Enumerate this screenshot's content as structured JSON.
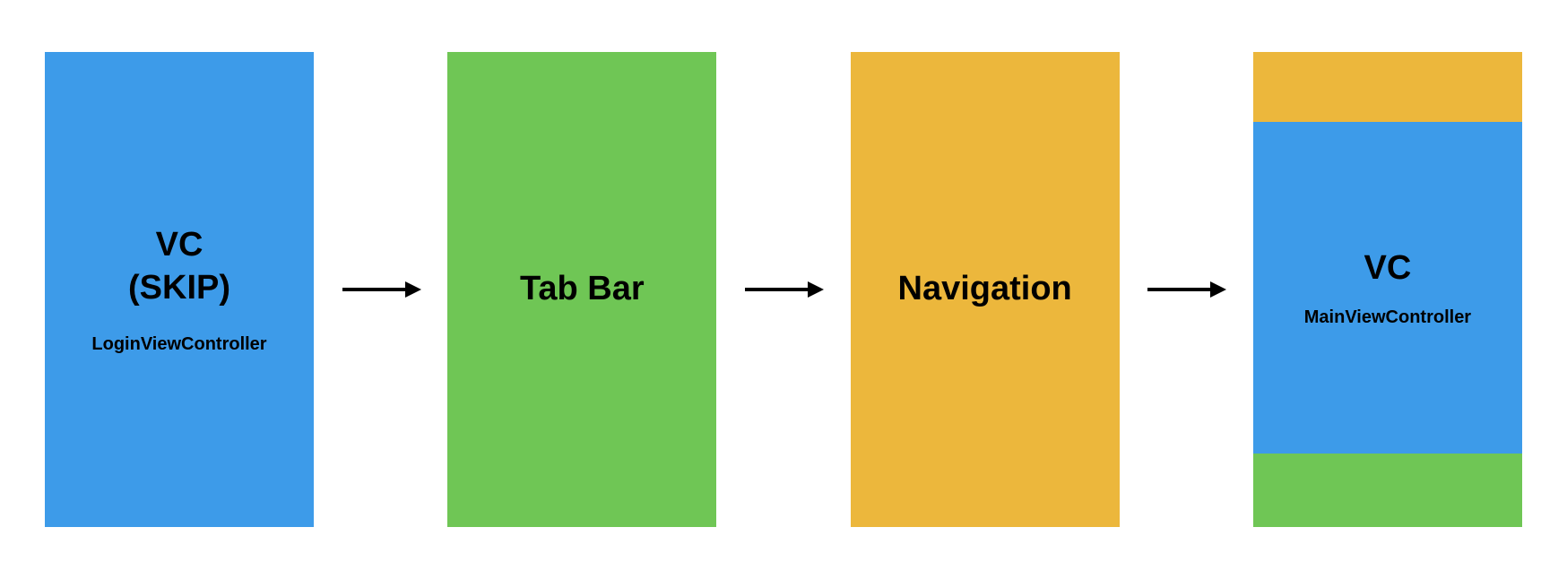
{
  "diagram": {
    "nodes": [
      {
        "type": "simple",
        "color": "blue",
        "title_line1": "VC",
        "title_line2": "(SKIP)",
        "subtitle": "LoginViewController"
      },
      {
        "type": "simple",
        "color": "green",
        "title": "Tab Bar"
      },
      {
        "type": "simple",
        "color": "yellow",
        "title": "Navigation"
      },
      {
        "type": "composite",
        "top_color": "yellow",
        "middle_color": "blue",
        "bottom_color": "green",
        "title": "VC",
        "subtitle": "MainViewController"
      }
    ],
    "colors": {
      "blue": "#3d9be9",
      "green": "#6fc655",
      "yellow": "#ecb73c"
    }
  }
}
